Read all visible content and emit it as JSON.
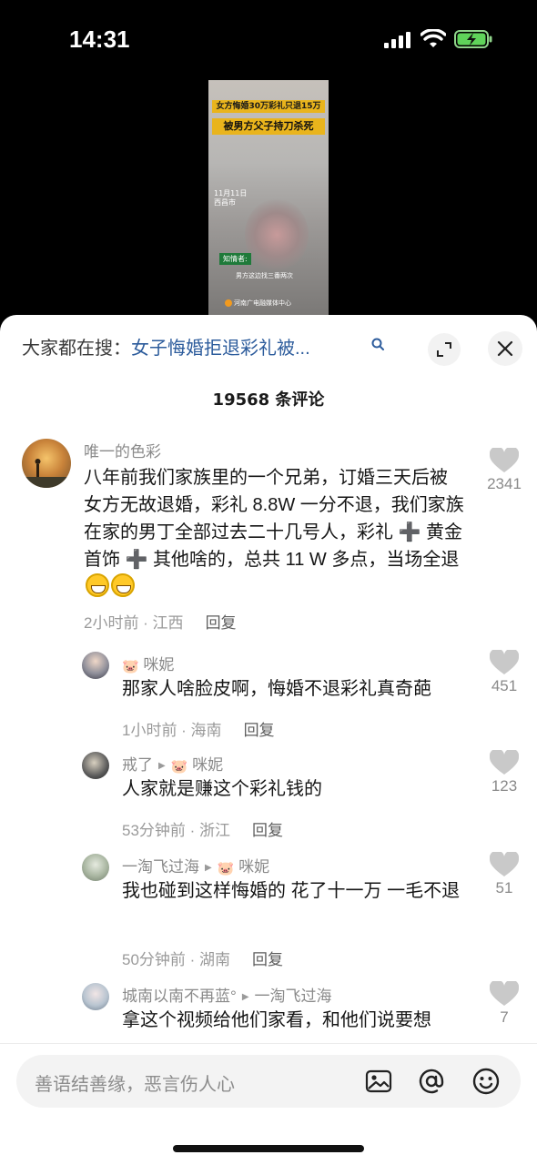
{
  "status_bar": {
    "time": "14:31"
  },
  "video": {
    "headline_1": "女方悔婚30万彩礼只退15万",
    "headline_2": "被男方父子持刀杀死",
    "date_text": "11月11日\n西昌市",
    "witness_label": "知情者:",
    "subtitle": "男方这边找三番两次",
    "brand": "河南广电融媒体中心"
  },
  "search": {
    "label": "大家都在搜：",
    "topic": "女子悔婚拒退彩礼被..."
  },
  "comment_count": "19568 条评论",
  "comments": [
    {
      "user": "唯一的色彩",
      "text": "八年前我们家族里的一个兄弟，订婚三天后被女方无故退婚，彩礼 8.8W 一分不退，我们家族在家的男丁全部过去二十几号人，彩礼 ➕ 黄金首饰 ➕ 其他啥的，总共 11 W 多点，当场全退",
      "time_loc": "2小时前 · 江西",
      "reply": "回复",
      "likes": "2341"
    },
    {
      "user": "咪妮",
      "text": "那家人啥脸皮啊，悔婚不退彩礼真奇葩",
      "time_loc": "1小时前 · 海南",
      "reply": "回复",
      "likes": "451"
    },
    {
      "user": "戒了",
      "reply_to": "咪妮",
      "text": "人家就是赚这个彩礼钱的",
      "time_loc": "53分钟前 · 浙江",
      "reply": "回复",
      "likes": "123"
    },
    {
      "user": "一淘飞过海",
      "reply_to": "咪妮",
      "text": "我也碰到这样悔婚的 花了十一万 一毛不退",
      "time_loc": "50分钟前 · 湖南",
      "reply": "回复",
      "likes": "51"
    },
    {
      "user": "城南以南不再蓝°",
      "reply_to": "一淘飞过海",
      "text": "拿这个视频给他们家看，和他们说要想",
      "likes": "7"
    }
  ],
  "input": {
    "placeholder": "善语结善缘，恶言伤人心"
  },
  "colors": {
    "accent_link": "#2d5c9c",
    "sheet_bg": "#ffffff",
    "emoji_yellow": "#ffc928"
  },
  "icons": [
    "search-icon",
    "expand-icon",
    "close-icon",
    "heart-icon",
    "image-icon",
    "at-icon",
    "emoji-icon",
    "pig-icon"
  ]
}
